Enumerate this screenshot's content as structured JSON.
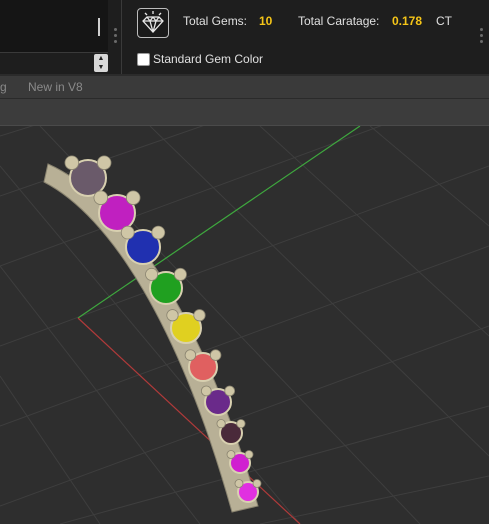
{
  "stats": {
    "total_gems_label": "Total Gems:",
    "total_gems_value": "10",
    "total_caratage_label": "Total Caratage:",
    "total_caratage_value": "0.178",
    "caratage_unit": "CT",
    "gem_icon": "diamond-icon",
    "value_color": "#f5c518"
  },
  "standard_gem_color": {
    "label": "Standard Gem Color",
    "checked": false
  },
  "tabs": [
    "g",
    "New in V8"
  ],
  "viewport": {
    "gem_colors": [
      "#6a5a6a",
      "#c020c0",
      "#2030b0",
      "#20a020",
      "#e0d020",
      "#e06060",
      "#6a2a8a",
      "#4a2a3a",
      "#d020d0",
      "#e030e0"
    ]
  }
}
